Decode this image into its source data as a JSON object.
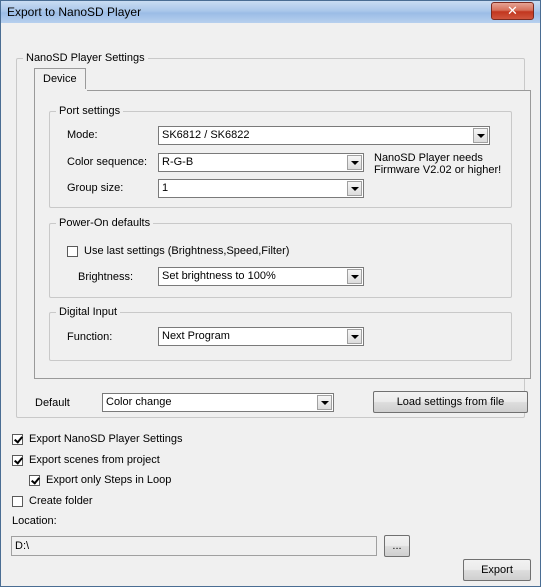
{
  "window": {
    "title": "Export to NanoSD Player",
    "close_glyph": "✕"
  },
  "settings_group": {
    "label": "NanoSD Player Settings"
  },
  "tabs": [
    {
      "label": "Device"
    }
  ],
  "port_settings": {
    "label": "Port settings",
    "mode": {
      "label": "Mode:",
      "value": "SK6812 / SK6822"
    },
    "color_sequence": {
      "label": "Color sequence:",
      "value": "R-G-B"
    },
    "group_size": {
      "label": "Group size:",
      "value": "1"
    },
    "firmware_note_line1": "NanoSD Player needs",
    "firmware_note_line2": "Firmware V2.02 or higher!"
  },
  "power_on": {
    "label": "Power-On defaults",
    "use_last_label": "Use last settings (Brightness,Speed,Filter)",
    "use_last_checked": false,
    "brightness": {
      "label": "Brightness:",
      "value": "Set brightness to 100%"
    }
  },
  "digital_input": {
    "label": "Digital Input",
    "function": {
      "label": "Function:",
      "value": "Next Program"
    }
  },
  "default": {
    "label": "Default",
    "value": "Color change"
  },
  "load_button": "Load settings from file",
  "options": {
    "export_settings": {
      "label": "Export NanoSD Player Settings",
      "checked": true
    },
    "export_scenes": {
      "label": "Export scenes from project",
      "checked": true
    },
    "export_steps": {
      "label": "Export only Steps in Loop",
      "checked": true
    },
    "create_folder": {
      "label": "Create folder",
      "checked": false
    }
  },
  "location": {
    "label": "Location:",
    "value": "D:\\",
    "browse_label": "..."
  },
  "export_button": "Export"
}
